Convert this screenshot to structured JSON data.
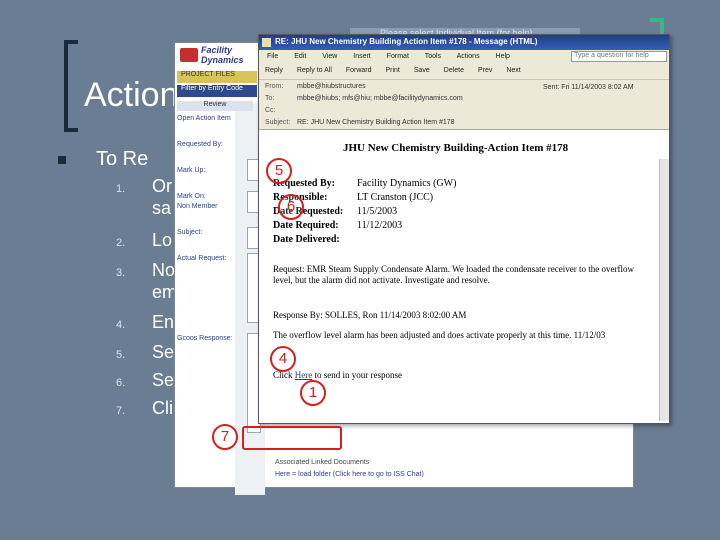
{
  "slide": {
    "title": "Action",
    "topband_text": "Please select Individual Item (for help)",
    "bullet": "To Re",
    "steps": [
      {
        "num": "1.",
        "text": "Or"
      },
      {
        "num": "",
        "text": "sa"
      },
      {
        "num": "2.",
        "text": "Lo"
      },
      {
        "num": "3.",
        "text": "No"
      },
      {
        "num": "",
        "text": "em"
      },
      {
        "num": "4.",
        "text": "En"
      },
      {
        "num": "5.",
        "text": "Se"
      },
      {
        "num": "6.",
        "text": "Se"
      },
      {
        "num": "7.",
        "text": "Cli"
      }
    ]
  },
  "facility_app": {
    "logo": "Facility Dynamics",
    "nav": "PROJECT FILES",
    "filter": "Filter by Entry Code",
    "table_header": "Review",
    "labels": [
      "Open Action Item",
      "Requested By:",
      "Mark Up:",
      "Mark On:",
      "Non Member",
      "Subject:",
      "Actual Request:",
      "Gcoos Response:"
    ],
    "footer_line1": "Associated Linked Documents",
    "footer_line2": "Here = load folder (Click here to go to ISS Chat)"
  },
  "email": {
    "window_title": "RE: JHU New Chemistry Building Action Item #178 - Message (HTML)",
    "menu": [
      "File",
      "Edit",
      "View",
      "Insert",
      "Format",
      "Tools",
      "Actions",
      "Help"
    ],
    "help_placeholder": "Type a question for help",
    "toolbar": [
      "Reply",
      "Reply to All",
      "Forward",
      "Print",
      "Save",
      "Delete",
      "Prev",
      "Next"
    ],
    "from_label": "From:",
    "from_value": "mbbe@hiubstructures",
    "to_label": "To:",
    "to_value": "mbbe@hiubs; mfs@hiu; mbbe@facilitydynamics.com",
    "cc_label": "Cc:",
    "cc_value": "",
    "subject_label": "Subject:",
    "subject_value": "RE: JHU New Chemistry Building Action Item #178",
    "sent": "Sent: Fri 11/14/2003 8:02 AM",
    "heading": "JHU New Chemistry Building-Action Item #178",
    "fields": [
      {
        "k": "Requested By:",
        "v": "Facility Dynamics (GW)"
      },
      {
        "k": "Responsible:",
        "v": "LT Cranston (JCC)"
      },
      {
        "k": "Date Requested:",
        "v": "11/5/2003"
      },
      {
        "k": "Date Required:",
        "v": "11/12/2003"
      },
      {
        "k": "Date Delivered:",
        "v": ""
      }
    ],
    "request": "Request: EMR Steam Supply Condensate Alarm. We loaded the condensate receiver to the overflow level, but the alarm did not activate. Investigate and resolve.",
    "response_by": "Response By: SOLLES, Ron 11/14/2003 8:02:00 AM",
    "response_text": "The overflow level alarm has been adjusted and does activate properly at this time. 11/12/03",
    "click_prefix": "Click ",
    "click_link": "Here",
    "click_suffix": " to send in your response"
  },
  "callouts": [
    "5",
    "6",
    "4",
    "1",
    "7"
  ]
}
